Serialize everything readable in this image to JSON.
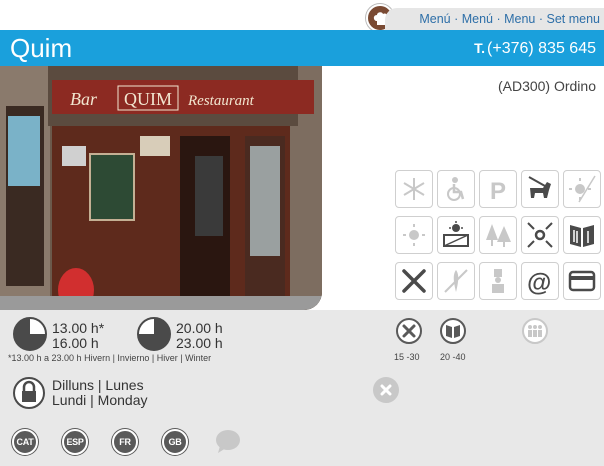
{
  "header": {
    "menu_links": "Menú · Menú · Menu · Set menu",
    "title": "Quim",
    "phone_prefix": "T.",
    "phone": "(+376) 835 645",
    "location": "(AD300) Ordino"
  },
  "photo": {
    "sign_left": "Bar",
    "sign_mid": "QUIM",
    "sign_right": "Restaurant"
  },
  "services": [
    {
      "icon": "snowflake-icon",
      "active": false
    },
    {
      "icon": "wheelchair-icon",
      "active": false
    },
    {
      "icon": "parking-icon",
      "active": false
    },
    {
      "icon": "dog-icon",
      "active": true
    },
    {
      "icon": "sun-icon",
      "active": false
    },
    {
      "icon": "sun-small-icon",
      "active": false
    },
    {
      "icon": "terrace-icon",
      "active": true
    },
    {
      "icon": "trees-icon",
      "active": false
    },
    {
      "icon": "center-icon",
      "active": true
    },
    {
      "icon": "menu-book-icon",
      "active": true
    },
    {
      "icon": "cutlery-icon",
      "active": true
    },
    {
      "icon": "gluten-free-icon",
      "active": false
    },
    {
      "icon": "chef-icon",
      "active": false
    },
    {
      "icon": "email-icon",
      "active": true
    },
    {
      "icon": "credit-card-icon",
      "active": true
    }
  ],
  "hours": {
    "lunch_open": "13.00 h*",
    "lunch_close": "16.00 h",
    "dinner_open": "20.00 h",
    "dinner_close": "23.00 h",
    "note": "*13.00 h a 23.00 h Hivern | Invierno | Hiver | Winter",
    "closed_line1": "Dilluns | Lunes",
    "closed_line2": "Lundi | Monday"
  },
  "prices": {
    "cutlery_range": "15 -30",
    "menu_range": "20 -40"
  },
  "languages": [
    "CAT",
    "ESP",
    "FR",
    "GB"
  ]
}
